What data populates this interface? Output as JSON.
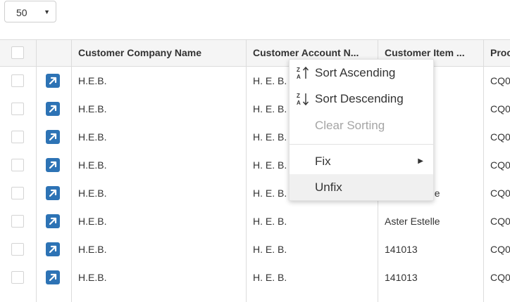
{
  "page_size": {
    "value": "50"
  },
  "columns": [
    "Customer Company Name",
    "Customer Account N...",
    "Customer Item ...",
    "Proc"
  ],
  "rows": [
    {
      "company": "H.E.B.",
      "account": "H. E. B.",
      "item": "",
      "proc": "CQ0"
    },
    {
      "company": "H.E.B.",
      "account": "H. E. B.",
      "item": "",
      "proc": "CQ0"
    },
    {
      "company": "H.E.B.",
      "account": "H. E. B.",
      "item": "",
      "proc": "CQ0"
    },
    {
      "company": "H.E.B.",
      "account": "H. E. B.",
      "item": "",
      "proc": "CQ0"
    },
    {
      "company": "H.E.B.",
      "account": "H. E. B.",
      "item": "Aster Estelle",
      "proc": "CQ0"
    },
    {
      "company": "H.E.B.",
      "account": "H. E. B.",
      "item": "Aster Estelle",
      "proc": "CQ0"
    },
    {
      "company": "H.E.B.",
      "account": "H. E. B.",
      "item": "141013",
      "proc": "CQ0"
    },
    {
      "company": "H.E.B.",
      "account": "H. E. B.",
      "item": "141013",
      "proc": "CQ0"
    }
  ],
  "context_menu": {
    "sort_ascending": "Sort Ascending",
    "sort_descending": "Sort Descending",
    "clear_sorting": "Clear Sorting",
    "fix": "Fix",
    "unfix": "Unfix"
  },
  "colors": {
    "accent": "#2d73b5",
    "header_bg": "#f5f5f5",
    "border": "#dcdcdc"
  }
}
